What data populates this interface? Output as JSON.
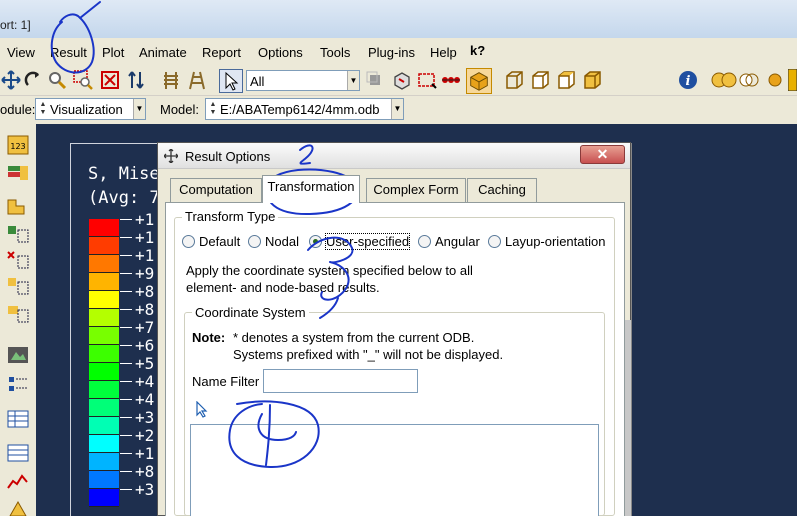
{
  "window": {
    "title_fragment": "ort: 1]"
  },
  "menu": {
    "items": [
      "View",
      "Result",
      "Plot",
      "Animate",
      "Report",
      "Options",
      "Tools",
      "Plug-ins",
      "Help"
    ],
    "help_cursor": "k?"
  },
  "toolbar": {
    "selection_filter": "All"
  },
  "context_bar": {
    "module_label": "odule:",
    "module_value": "Visualization",
    "model_label": "Model:",
    "model_value": "E:/ABATemp6142/4mm.odb"
  },
  "viewport": {
    "legend_title_line1": "S, Mises",
    "legend_title_line2": "(Avg: 7",
    "legend_values": [
      "+1",
      "+1",
      "+1",
      "+9",
      "+8",
      "+8",
      "+7",
      "+6",
      "+5",
      "+4",
      "+4",
      "+3",
      "+2",
      "+1",
      "+8",
      "+3"
    ],
    "legend_colors": [
      "#ff0000",
      "#ff3c00",
      "#ff7800",
      "#ffb400",
      "#ffff00",
      "#b4ff00",
      "#78ff00",
      "#3cff00",
      "#00ff00",
      "#00ff3c",
      "#00ff78",
      "#00ffb4",
      "#00ffff",
      "#00b4ff",
      "#0078ff",
      "#0000ff"
    ]
  },
  "dialog": {
    "title": "Result Options",
    "tabs": [
      "Computation",
      "Transformation",
      "Complex Form",
      "Caching"
    ],
    "active_tab": "Transformation",
    "transform_type_label": "Transform Type",
    "transform_options": [
      "Default",
      "Nodal",
      "User-specified",
      "Angular",
      "Layup-orientation"
    ],
    "transform_selected": "User-specified",
    "description_line1": "Apply the coordinate system specified below to all",
    "description_line2": "element- and node-based results.",
    "coord_system_label": "Coordinate System",
    "note_label": "Note:",
    "note_line1": "* denotes a system from the current ODB.",
    "note_line2": "Systems prefixed with \"_\" will not be displayed.",
    "name_filter_label": "Name Filter",
    "name_filter_value": ""
  },
  "annotations": {
    "marks": [
      "1",
      "2",
      "3",
      "4"
    ],
    "color": "#1a35c8"
  }
}
